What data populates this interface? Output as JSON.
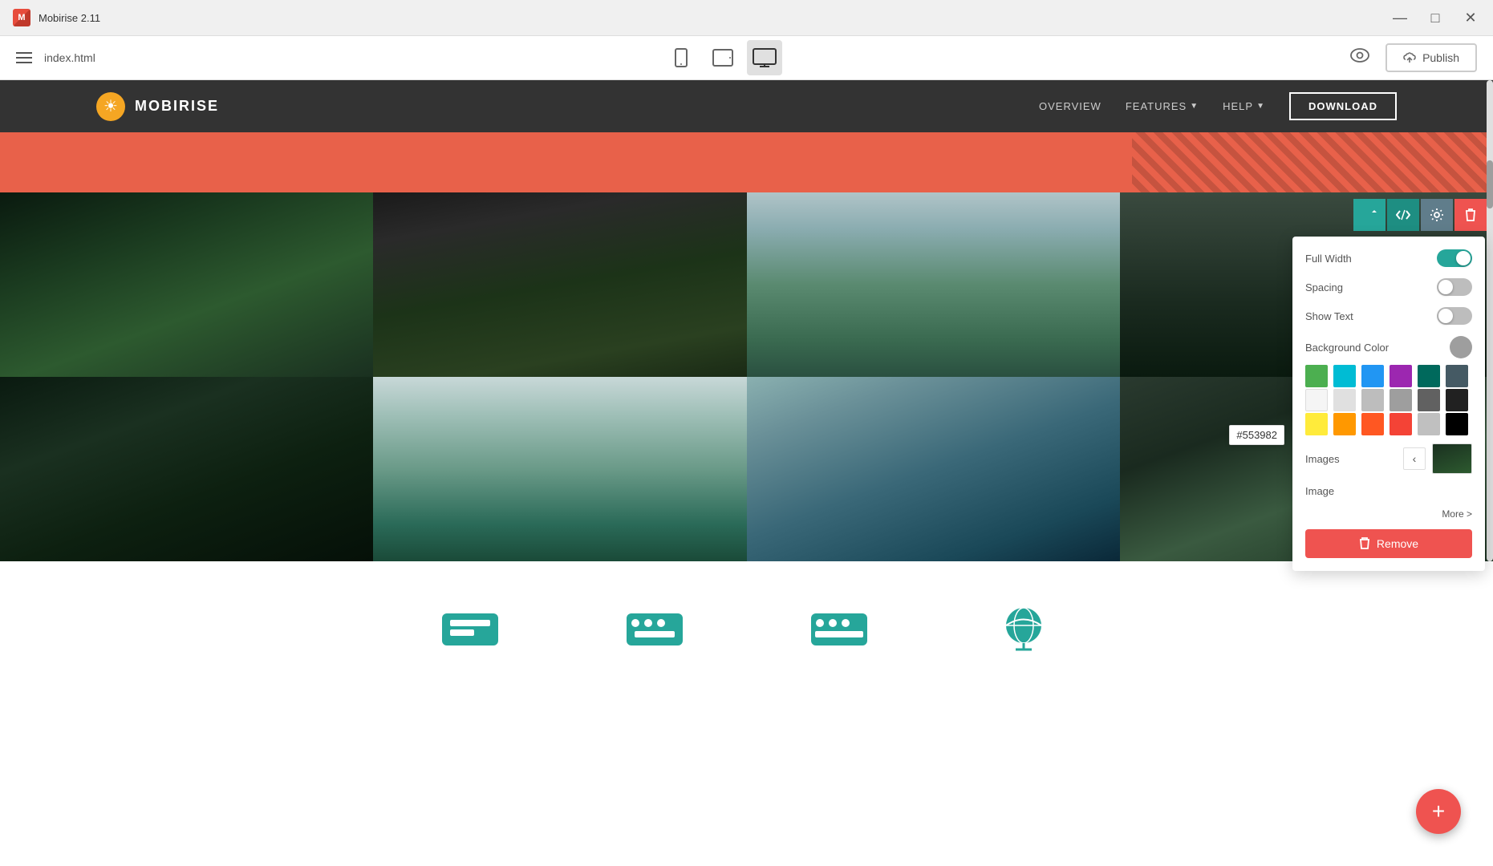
{
  "app": {
    "title": "Mobirise 2.11",
    "logo": "M",
    "file": "index.html"
  },
  "titlebar": {
    "minimize_label": "—",
    "maximize_label": "□",
    "close_label": "✕"
  },
  "toolbar": {
    "hamburger_label": "≡",
    "filename": "index.html",
    "devices": [
      {
        "id": "mobile",
        "label": "Mobile"
      },
      {
        "id": "tablet",
        "label": "Tablet"
      },
      {
        "id": "desktop",
        "label": "Desktop",
        "active": true
      }
    ],
    "publish_label": "Publish"
  },
  "website_nav": {
    "logo": "☀",
    "brand": "MOBIRISE",
    "links": [
      {
        "label": "OVERVIEW"
      },
      {
        "label": "FEATURES",
        "has_arrow": true
      },
      {
        "label": "HELP",
        "has_arrow": true
      }
    ],
    "download_label": "DOWNLOAD"
  },
  "gallery_toolbar": {
    "buttons": [
      {
        "id": "sort",
        "color": "teal",
        "icon": "⇅"
      },
      {
        "id": "code",
        "color": "dark-teal",
        "icon": "</>"
      },
      {
        "id": "settings",
        "color": "gray",
        "icon": "⚙"
      },
      {
        "id": "delete",
        "color": "red",
        "icon": "🗑"
      }
    ]
  },
  "settings_panel": {
    "full_width_label": "Full Width",
    "full_width_value": true,
    "spacing_label": "Spacing",
    "spacing_value": false,
    "show_text_label": "Show Text",
    "show_text_value": false,
    "background_color_label": "Background Color",
    "images_label": "Images",
    "image_label": "Image",
    "more_label": "More >",
    "remove_label": "Remove",
    "color_hex": "#553982",
    "colors": [
      "#4caf50",
      "#00bcd4",
      "#2196f3",
      "#9c27b0",
      "#00695c",
      "#455a64",
      "#f5f5f5",
      "#e0e0e0",
      "#bdbdbd",
      "#9e9e9e",
      "#616161",
      "#212121",
      "#ffeb3b",
      "#ff9800",
      "#ff5722",
      "#f44336",
      "#c0c0c0",
      "#000000"
    ]
  },
  "color_tooltip": "#553982",
  "remove_button_label": "Remove",
  "fab_label": "+",
  "bottom_icons": [
    {
      "id": "icon1"
    },
    {
      "id": "icon2"
    },
    {
      "id": "icon3"
    },
    {
      "id": "icon4"
    }
  ]
}
